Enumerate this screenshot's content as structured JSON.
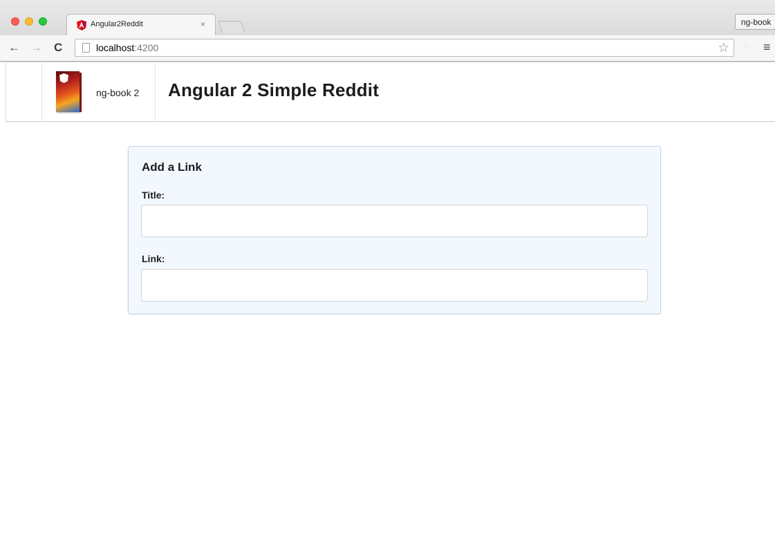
{
  "browser": {
    "tab_title": "Angular2Reddit",
    "tab_close_glyph": "×",
    "profile_label": "ng-book",
    "back_glyph": "←",
    "forward_glyph": "→",
    "reload_glyph": "C",
    "url_host": "localhost",
    "url_port": ":4200",
    "star_glyph": "☆",
    "menu_glyph": "≡",
    "icons": [
      "angular-favicon-icon",
      "back-arrow-icon",
      "forward-arrow-icon",
      "reload-icon",
      "page-icon",
      "bookmark-star-icon",
      "chrome-menu-icon"
    ]
  },
  "header": {
    "brand_label": "ng-book 2",
    "title": "Angular 2 Simple Reddit"
  },
  "form": {
    "heading": "Add a Link",
    "title_label": "Title:",
    "title_value": "",
    "link_label": "Link:",
    "link_value": ""
  },
  "colors": {
    "form_background": "#f2f8fe",
    "angular_red": "#dd1b16",
    "traffic_red": "#fc5f57",
    "traffic_yellow": "#fdbc2e",
    "traffic_green": "#28c840"
  }
}
